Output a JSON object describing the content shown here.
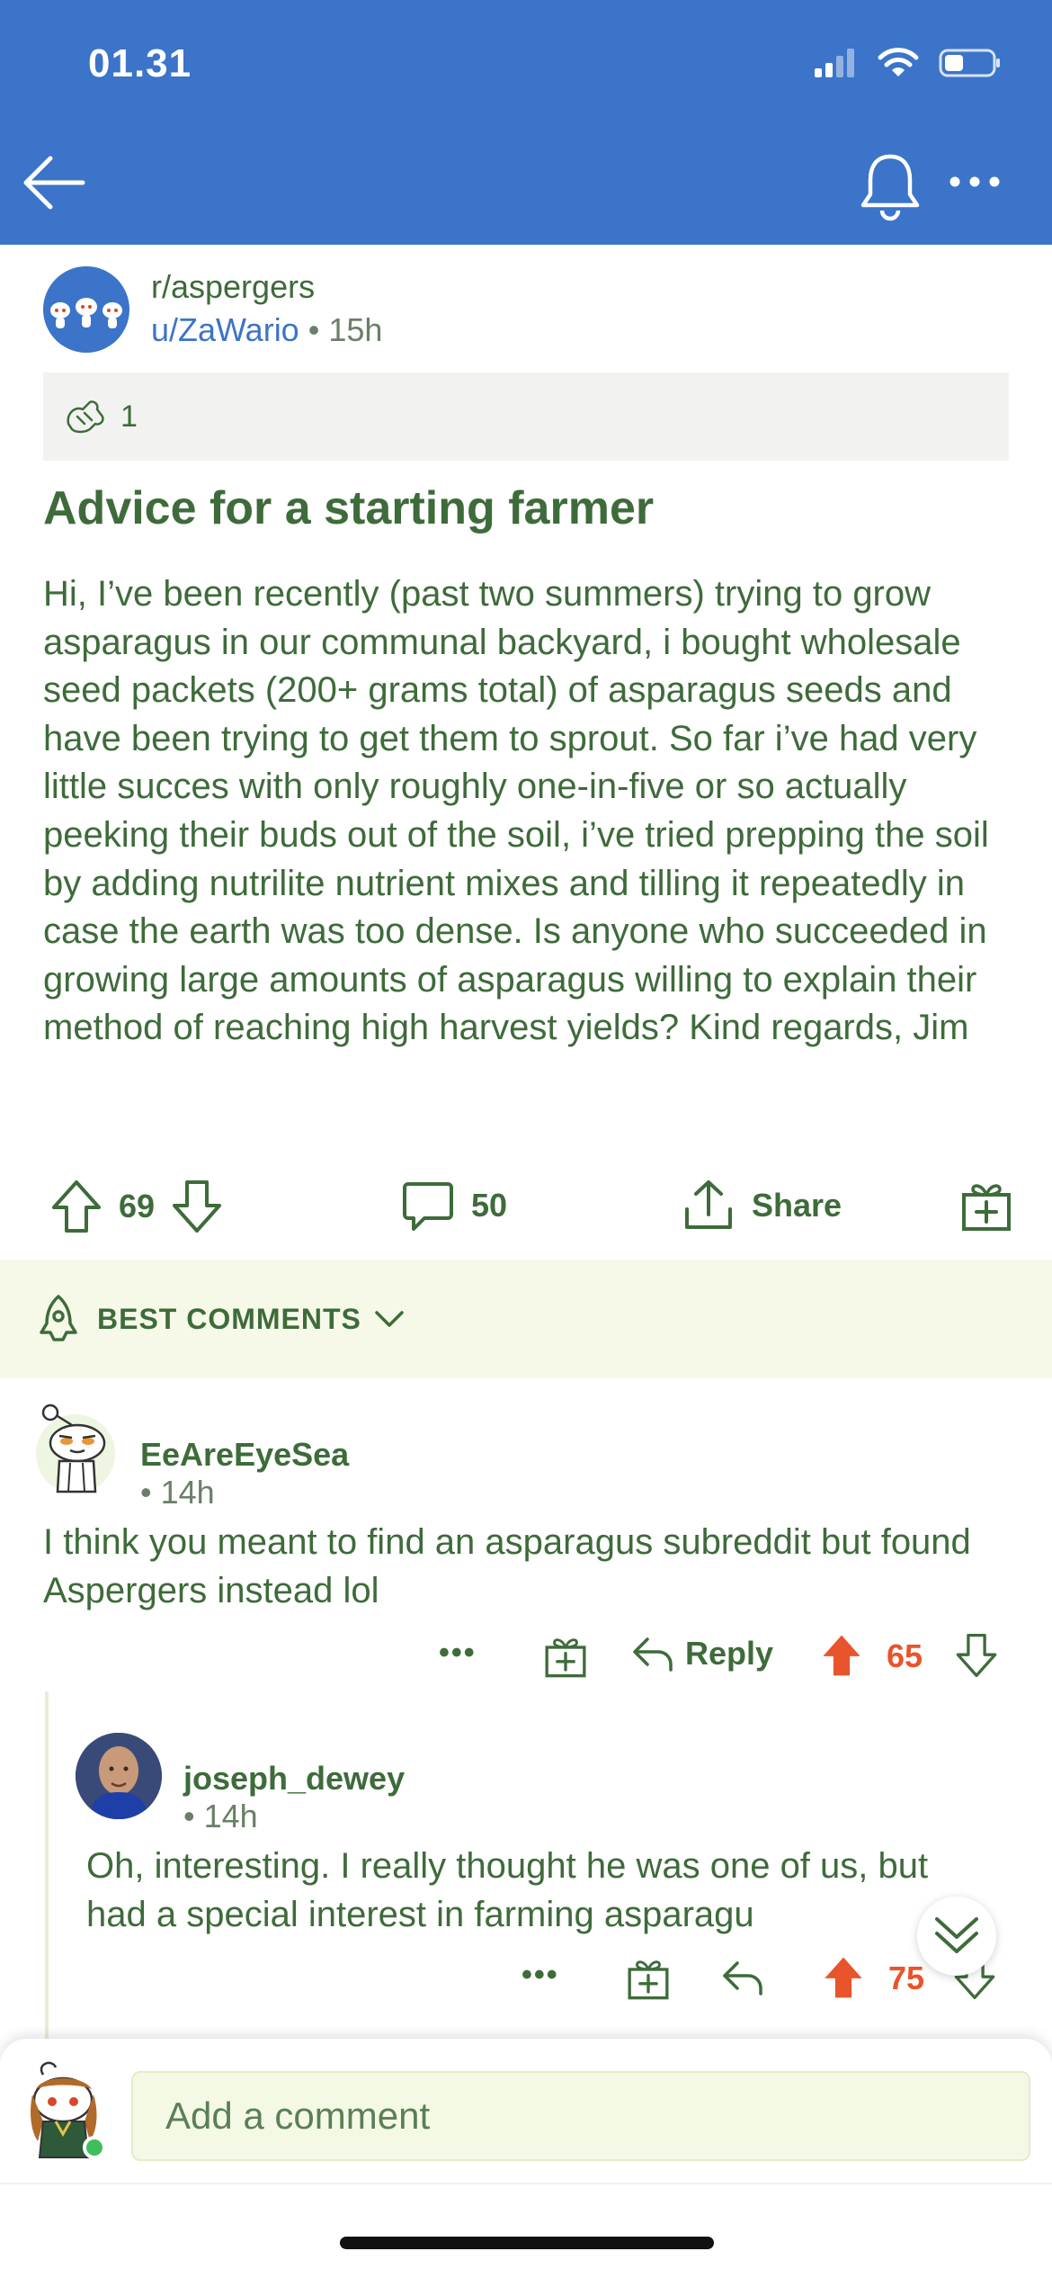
{
  "status_bar": {
    "time": "01.31"
  },
  "post": {
    "subreddit": "r/aspergers",
    "author": "u/ZaWario",
    "age": "15h",
    "award_count": "1",
    "title": "Advice for a starting farmer",
    "body": "Hi, I’ve been recently (past two summers) trying to grow asparagus in our communal backyard, i bought wholesale seed packets (200+ grams total) of asparagus seeds and have been trying to get them to sprout. So far i’ve had very little succes with only roughly one-in-five or so actually peeking their buds out of the soil, i’ve tried prepping the soil by adding nutrilite nutrient mixes and tilling it repeatedly in case the earth was too dense. Is anyone who succeeded in growing large amounts of asparagus willing to explain their method of reaching high harvest yields? Kind regards, Jim",
    "upvotes": "69",
    "comments": "50",
    "share_label": "Share"
  },
  "sort": {
    "label": "BEST COMMENTS"
  },
  "comments": [
    {
      "user": "EeAreEyeSea",
      "age": "14h",
      "text": "I think you meant to find an asparagus subreddit but found Aspergers instead lol",
      "more": "•••",
      "reply_label": "Reply",
      "score": "65"
    },
    {
      "user": "joseph_dewey",
      "age": "14h",
      "text": "Oh, interesting. I really thought he was one of us, but had a special interest in farming asparagu",
      "more": "•••",
      "score": "75"
    }
  ],
  "composer": {
    "placeholder": "Add a comment"
  },
  "colors": {
    "header": "#3b74c9",
    "text_green": "#3e6b3a",
    "upvote_orange": "#e8542b",
    "best_bar_bg": "#f6f9e8"
  },
  "icons": [
    "back-arrow-icon",
    "bell-icon",
    "more-icon",
    "award-icon",
    "upvote-icon",
    "downvote-icon",
    "comment-icon",
    "share-icon",
    "gift-icon",
    "rocket-icon",
    "chevron-down-icon",
    "reply-icon",
    "scroll-down-icon"
  ]
}
